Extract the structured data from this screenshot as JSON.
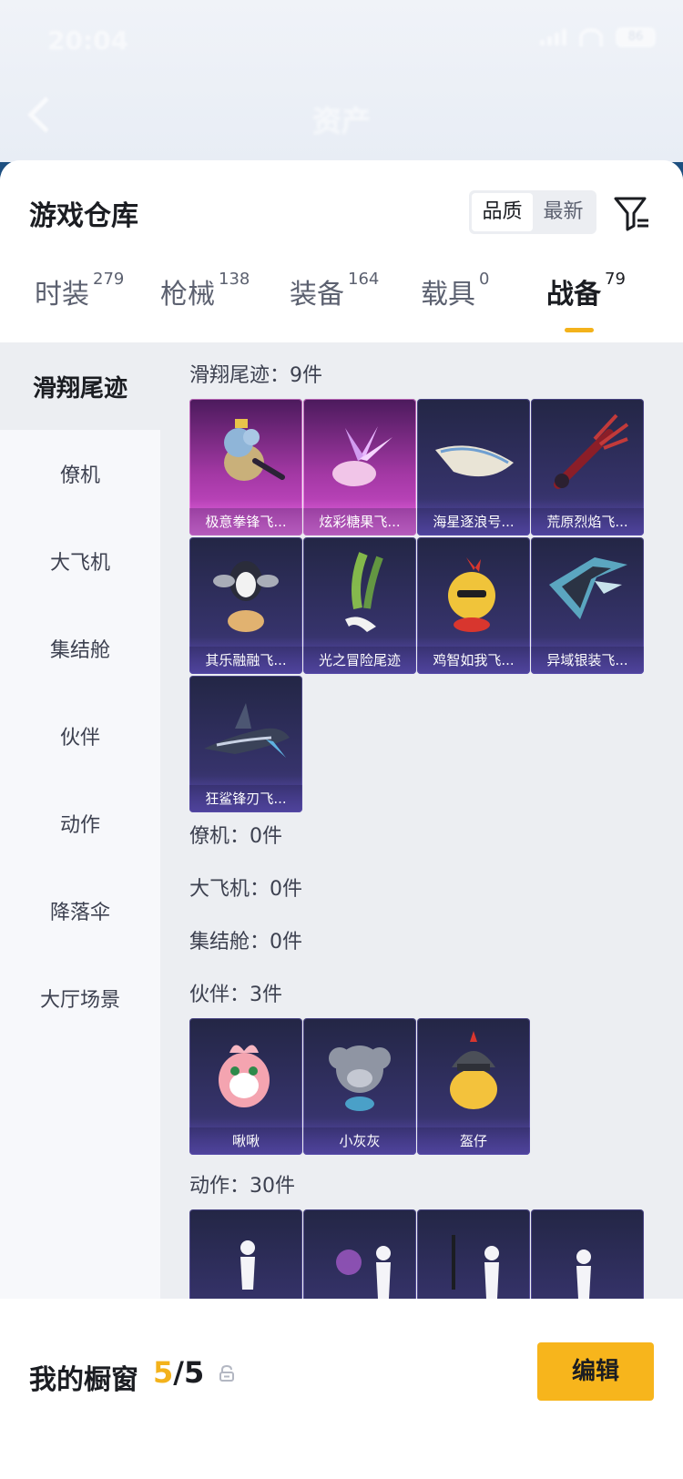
{
  "status_bar": {
    "time": "20:04",
    "battery": "86"
  },
  "nav": {
    "title": "资产"
  },
  "warehouse": {
    "title": "游戏仓库",
    "sort_options": [
      "品质",
      "最新"
    ],
    "tabs": [
      {
        "label": "时装",
        "count": "279"
      },
      {
        "label": "枪械",
        "count": "138"
      },
      {
        "label": "装备",
        "count": "164"
      },
      {
        "label": "载具",
        "count": "0"
      },
      {
        "label": "战备",
        "count": "79"
      }
    ]
  },
  "sidebar": {
    "items": [
      "滑翔尾迹",
      "僚机",
      "大飞机",
      "集结舱",
      "伙伴",
      "动作",
      "降落伞",
      "大厅场景"
    ]
  },
  "sections": {
    "trail": {
      "title": "滑翔尾迹：9件",
      "items": [
        "极意拳锋飞...",
        "炫彩糖果飞...",
        "海星逐浪号...",
        "荒原烈焰飞...",
        "其乐融融飞...",
        "光之冒险尾迹",
        "鸡智如我飞...",
        "异域银装飞...",
        "狂鲨锋刃飞..."
      ]
    },
    "wingman": {
      "title": "僚机：0件"
    },
    "plane": {
      "title": "大飞机：0件"
    },
    "pod": {
      "title": "集结舱：0件"
    },
    "partner": {
      "title": "伙伴：3件",
      "items": [
        "啾啾",
        "小灰灰",
        "盔仔"
      ]
    },
    "emote": {
      "title": "动作：30件"
    }
  },
  "bottom": {
    "label": "我的橱窗",
    "count_current": "5",
    "count_total": "/5",
    "edit": "编辑"
  },
  "colors": {
    "accent": "#f7b51c",
    "card_purple": "#3b3670",
    "card_pink": "#c546c3"
  }
}
